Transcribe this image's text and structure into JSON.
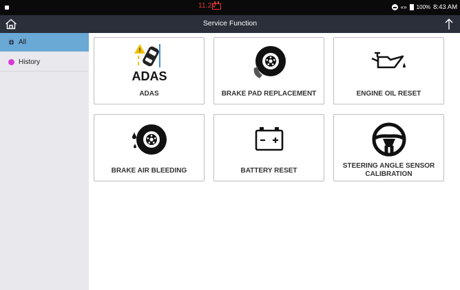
{
  "status_bar": {
    "voltage": "11.2V",
    "extra": "«»",
    "battery": "100%",
    "time": "8:43 AM"
  },
  "header": {
    "title": "Service Function",
    "home_icon": "home-icon",
    "upload_icon": "upload-icon"
  },
  "sidebar": {
    "items": [
      {
        "label": "All",
        "icon": "globe-icon",
        "color": "#1b3a57",
        "active": true
      },
      {
        "label": "History",
        "icon": "history-icon",
        "color": "#d83ad8",
        "active": false
      }
    ]
  },
  "functions": [
    {
      "label": "ADAS",
      "icon": "adas-icon",
      "icon_text": "ADAS"
    },
    {
      "label": "BRAKE PAD REPLACEMENT",
      "icon": "brake-disc-icon"
    },
    {
      "label": "ENGINE OIL RESET",
      "icon": "oil-can-icon"
    },
    {
      "label": "BRAKE AIR BLEEDING",
      "icon": "brake-bleed-icon"
    },
    {
      "label": "BATTERY RESET",
      "icon": "battery-icon"
    },
    {
      "label": "STEERING ANGLE SENSOR CALIBRATION",
      "icon": "steering-wheel-icon"
    }
  ],
  "colors": {
    "title_bar": "#2b2f3a",
    "status_bar": "#0a0a0a",
    "sidebar_active": "#6aa8d6",
    "sidebar_bg": "#e9e9ed",
    "alert": "#e53935",
    "warning": "#f2c200"
  }
}
